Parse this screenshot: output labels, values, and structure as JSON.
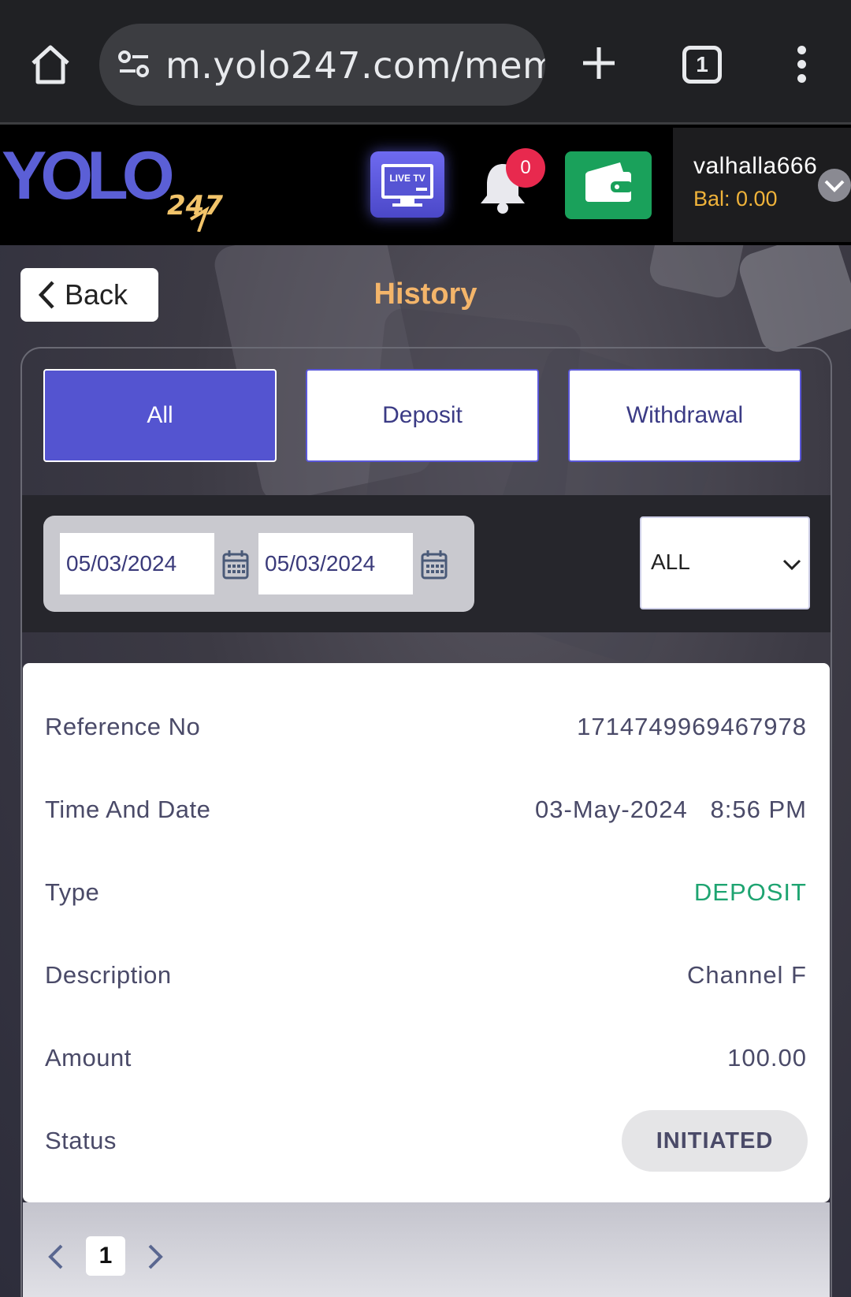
{
  "browser": {
    "url": "m.yolo247.com/memb",
    "tab_count": "1"
  },
  "header": {
    "logo_text": "YOLO247",
    "live_tv_label": "LIVE TV",
    "notification_count": "0",
    "username": "valhalla666",
    "balance": "Bal: 0.00"
  },
  "page": {
    "back_label": "Back",
    "title": "History"
  },
  "tabs": [
    {
      "label": "All",
      "active": true
    },
    {
      "label": "Deposit",
      "active": false
    },
    {
      "label": "Withdrawal",
      "active": false
    }
  ],
  "filters": {
    "from_date": "05/03/2024",
    "to_date": "05/03/2024",
    "type_selected": "ALL"
  },
  "transaction": {
    "reference_label": "Reference No",
    "reference_value": "1714749969467978",
    "time_label": "Time And Date",
    "time_value": "03-May-2024   8:56 PM",
    "type_label": "Type",
    "type_value": "DEPOSIT",
    "description_label": "Description",
    "description_value": "Channel F",
    "amount_label": "Amount",
    "amount_value": "100.00",
    "status_label": "Status",
    "status_value": "INITIATED"
  },
  "pagination": {
    "current_page": "1"
  },
  "colors": {
    "accent": "#5454d0",
    "title": "#f4b56a",
    "balance": "#f0b33a",
    "deposit": "#1ea471",
    "badge": "#e8294e",
    "wallet": "#1aa15b"
  }
}
